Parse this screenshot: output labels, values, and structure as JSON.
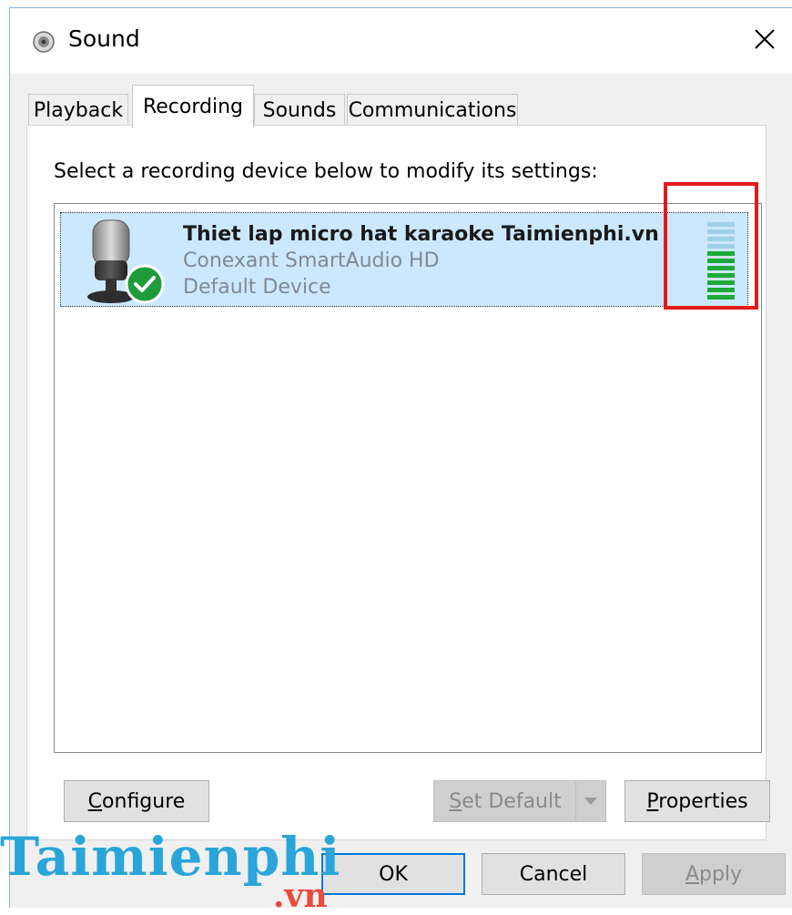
{
  "window": {
    "title": "Sound",
    "title_icon": "speaker-icon",
    "close_label": "×"
  },
  "tabs": [
    {
      "label": "Playback",
      "active": false
    },
    {
      "label": "Recording",
      "active": true
    },
    {
      "label": "Sounds",
      "active": false
    },
    {
      "label": "Communications",
      "active": false
    }
  ],
  "recording": {
    "instruction": "Select a recording device below to modify its settings:",
    "devices": [
      {
        "name": "Thiet lap micro hat karaoke Taimienphi.vn",
        "driver": "Conexant SmartAudio HD",
        "status": "Default Device",
        "icon": "microphone-icon",
        "badge_icon": "checkmark-icon",
        "selected": true,
        "level_bars_total": 11,
        "level_bars_active": 7
      }
    ]
  },
  "buttons": {
    "configure": {
      "prefix": "",
      "accel": "C",
      "rest": "onfigure",
      "enabled": true
    },
    "set_default": {
      "prefix": "",
      "accel": "S",
      "rest": "et Default",
      "enabled": false
    },
    "properties": {
      "prefix": "",
      "accel": "P",
      "rest": "roperties",
      "enabled": true
    },
    "ok": {
      "label": "OK",
      "enabled": true
    },
    "cancel": {
      "label": "Cancel",
      "enabled": true
    },
    "apply": {
      "prefix": "",
      "accel": "A",
      "rest": "pply",
      "enabled": false
    }
  },
  "colors": {
    "selection": "#cce8ff",
    "highlight": "#e21b1b",
    "meter_active": "#1fa83a",
    "meter_inactive": "#9fd0ea",
    "badge": "#1e9b3a"
  },
  "watermark": {
    "text": "Taimienphi",
    "sub": ".vn"
  }
}
